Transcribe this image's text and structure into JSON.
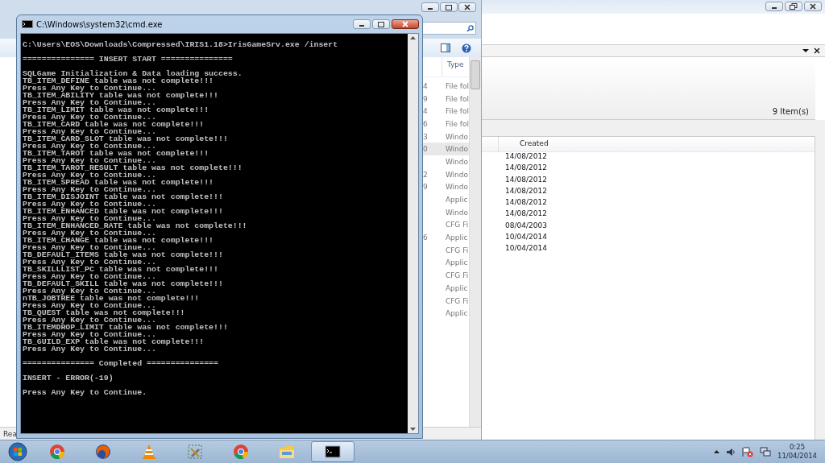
{
  "back_window": {
    "item_count": "9 Item(s)",
    "table": {
      "columns": [
        "Created"
      ],
      "rows": [
        "14/08/2012",
        "14/08/2012",
        "14/08/2012",
        "14/08/2012",
        "14/08/2012",
        "14/08/2012",
        "08/04/2003",
        "10/04/2014",
        "10/04/2014"
      ]
    }
  },
  "explorer": {
    "columns": [
      "Type"
    ],
    "rows": [
      {
        "size": "4",
        "type": "File fol",
        "selected": false
      },
      {
        "size": "9",
        "type": "File fol",
        "selected": false
      },
      {
        "size": "4",
        "type": "File fol",
        "selected": false
      },
      {
        "size": "6",
        "type": "File fol",
        "selected": false
      },
      {
        "size": "3",
        "type": "Windo",
        "selected": false
      },
      {
        "size": "0",
        "type": "Windo",
        "selected": true
      },
      {
        "type": "Windo",
        "selected": false
      },
      {
        "size": "2",
        "type": "Windo",
        "selected": false
      },
      {
        "size": "9",
        "type": "Windo",
        "selected": false
      },
      {
        "type": "Applic",
        "selected": false
      },
      {
        "type": "Windo",
        "selected": false
      },
      {
        "type": "CFG Fi",
        "selected": false
      },
      {
        "size": "6",
        "type": "Applic",
        "selected": false
      },
      {
        "type": "CFG Fi",
        "selected": false
      },
      {
        "type": "Applic",
        "selected": false
      },
      {
        "type": "CFG Fi",
        "selected": false
      },
      {
        "type": "Applic",
        "selected": false
      },
      {
        "type": "CFG Fi",
        "selected": false
      },
      {
        "type": "Applic",
        "selected": false
      }
    ],
    "status": "Rea"
  },
  "console_window": {
    "title": "C:\\Windows\\system32\\cmd.exe",
    "blocks": [
      [
        "C:\\Users\\EOS\\Downloads\\Compressed\\IRIS1.18>IrisGameSrv.exe /insert"
      ],
      [
        "=============== INSERT START ==============="
      ],
      [
        "SQLGame Initialization & Data loading success.",
        "TB_ITEM_DEFINE table was not complete!!!",
        "Press Any Key to Continue...",
        "TB_ITEM_ABILITY table was not complete!!!",
        "Press Any Key to Continue...",
        "TB_ITEM_LIMIT table was not complete!!!",
        "Press Any Key to Continue...",
        "TB_ITEM_CARD table was not complete!!!",
        "Press Any Key to Continue...",
        "TB_ITEM_CARD_SLOT table was not complete!!!",
        "Press Any Key to Continue...",
        "TB_ITEM_TAROT table was not complete!!!",
        "Press Any Key to Continue...",
        "TB_ITEM_TAROT_RESULT table was not complete!!!",
        "Press Any Key to Continue...",
        "TB_ITEM_SPREAD table was not complete!!!",
        "Press Any Key to Continue...",
        "TB_ITEM_DISJOINT table was not complete!!!",
        "Press Any Key to Continue...",
        "TB_ITEM_ENHANCED table was not complete!!!",
        "Press Any Key to Continue...",
        "TB_ITEM_ENHANCED_RATE table was not complete!!!",
        "Press Any Key to Continue...",
        "TB_ITEM_CHANGE table was not complete!!!",
        "Press Any Key to Continue...",
        "TB_DEFAULT_ITEMS table was not complete!!!",
        "Press Any Key to Continue...",
        "TB_SKILLLIST_PC table was not complete!!!",
        "Press Any Key to Continue...",
        "TB_DEFAULT_SKILL table was not complete!!!",
        "Press Any Key to Continue...",
        "nTB_JOBTREE table was not complete!!!",
        "Press Any Key to Continue...",
        "TB_QUEST table was not complete!!!",
        "Press Any Key to Continue...",
        "TB_ITEMDROP_LIMIT table was not complete!!!",
        "Press Any Key to Continue...",
        "TB_GUILD_EXP table was not complete!!!",
        "Press Any Key to Continue..."
      ],
      [
        "=============== Completed ==============="
      ],
      [
        "INSERT - ERROR(-19)"
      ],
      [
        "Press Any Key to Continue."
      ]
    ]
  },
  "taskbar": {
    "items": [
      {
        "kind": "chrome",
        "active": false
      },
      {
        "kind": "firefox",
        "active": false
      },
      {
        "kind": "vlc",
        "active": false
      },
      {
        "kind": "tools",
        "active": false
      },
      {
        "kind": "chrome",
        "active": false
      },
      {
        "kind": "folder",
        "active": false
      },
      {
        "kind": "console",
        "active": true
      }
    ],
    "clock": {
      "time": "0:25",
      "date": "11/04/2014"
    }
  }
}
